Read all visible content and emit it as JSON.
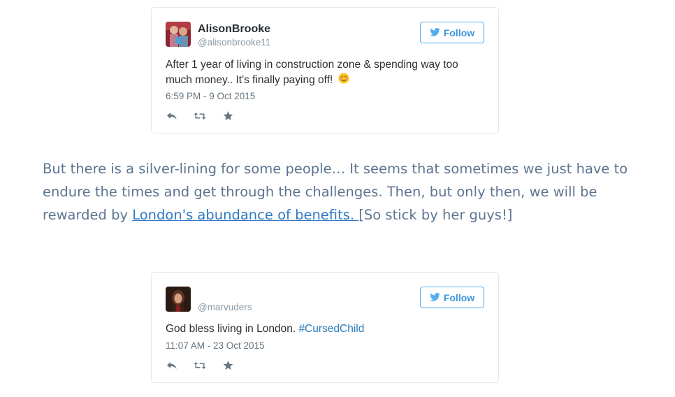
{
  "tweets": [
    {
      "display_name": "AlisonBrooke",
      "handle": "@alisonbrooke11",
      "follow_label": "Follow",
      "text": "After 1 year of living in construction zone & spending way too much money.. It's finally paying off!",
      "emoji": "☺",
      "timestamp": "6:59 PM - 9 Oct 2015",
      "actions": [
        "reply-icon",
        "retweet-icon",
        "favorite-icon"
      ]
    },
    {
      "display_name": "",
      "handle": "@marvuders",
      "follow_label": "Follow",
      "text": "God bless living in London.",
      "hashtag": "#CursedChild",
      "timestamp": "11:07 AM - 23 Oct 2015",
      "actions": [
        "reply-icon",
        "retweet-icon",
        "favorite-icon"
      ]
    }
  ],
  "article": {
    "text_before": "But there is a silver-lining for some people… It seems that sometimes we just have to endure the times and get through the challenges. Then, but only then, we will be rewarded by",
    "link_text": "London's abundance of benefits. ",
    "text_after": "[So stick by her guys!]"
  },
  "colors": {
    "twitter_blue": "#55acee",
    "link": "#2f78c4",
    "article_text": "#5d7491"
  }
}
